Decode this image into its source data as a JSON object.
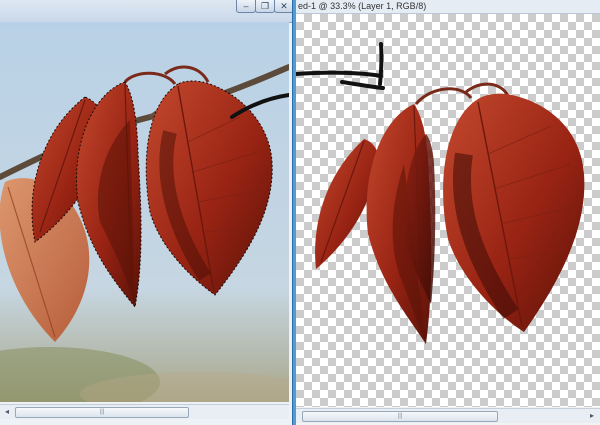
{
  "left_window": {
    "controls": {
      "minimize_glyph": "–",
      "restore_glyph": "❐",
      "close_glyph": "✕"
    },
    "image_description": "Photo of three red autumn leaves hanging from a twig against blue sky, selection marquee around leaves"
  },
  "right_window": {
    "title": "ed-1 @ 33.3% (Layer 1, RGB/8)",
    "image_description": "Same leaves extracted onto transparent checkerboard layer"
  },
  "scrollbar": {
    "thumb_grip": "|||",
    "left_arrow": "◂",
    "right_arrow": "▸"
  },
  "annotation": {
    "arrow": "hand-drawn black arrow from left leaves to right copy"
  },
  "colors": {
    "window_frame": "#4f9cd6",
    "checker_dark": "#cccccc",
    "checker_light": "#ffffff",
    "leaf_red": "#a8321e",
    "leaf_dark": "#5a1208"
  }
}
